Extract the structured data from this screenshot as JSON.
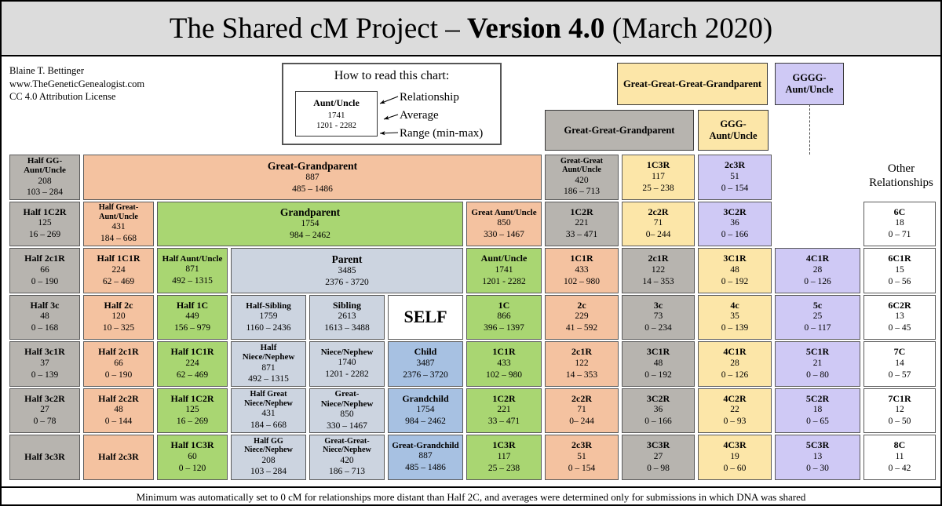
{
  "header": {
    "title_plain_1": "The Shared cM Project – ",
    "title_bold": "Version 4.0",
    "title_plain_2": " (March 2020)",
    "title_full": "The Shared cM Project – Version 4.0 (March 2020)"
  },
  "credits": {
    "line1": "Blaine T. Bettinger",
    "line2": "www.TheGeneticGenealogist.com",
    "line3": "CC 4.0 Attribution License"
  },
  "legend": {
    "title": "How to read this chart:",
    "sample_relationship": "Aunt/Uncle",
    "sample_average": "1741",
    "sample_range": "1201 - 2282",
    "label_relationship": "Relationship",
    "label_average": "Average",
    "label_range": "Range (min-max)"
  },
  "other_relationships_header": "Other\nRelationships",
  "other_relationships_header_line1": "Other",
  "other_relationships_header_line2": "Relationships",
  "footnote": "Minimum was automatically set to 0 cM for relationships more distant than Half 2C, and averages were determined only for submissions in which DNA was shared",
  "colors": {
    "banner": "#dcdcdc",
    "gray": "#b7b4af",
    "salmon": "#f4c2a0",
    "green": "#a9d672",
    "light_blue_gray": "#ccd4e0",
    "blue": "#a7c1e2",
    "yellow": "#fce6a8",
    "purple": "#cfc9f5",
    "white": "#ffffff",
    "border": "#5a5a5a"
  },
  "ancestor_boxes": [
    {
      "label": "Great-Great-Great-Grandparent",
      "color": "yellow"
    },
    {
      "label": "GGGG-Aunt/Uncle",
      "color": "purple"
    },
    {
      "label": "Great-Great-Grandparent",
      "color": "gray"
    },
    {
      "label": "GGG-Aunt/Uncle",
      "color": "yellow"
    }
  ],
  "chart_data": {
    "type": "table",
    "title": "The Shared cM Project – Version 4.0 (March 2020)",
    "units": "centimorgans (cM)",
    "rows": [
      [
        {
          "rel": "Half GG-Aunt/Uncle",
          "avg": "208",
          "rng": "103 – 284",
          "color": "gray"
        },
        {
          "rel": "Great-Grandparent",
          "avg": "887",
          "rng": "485 – 1486",
          "color": "salmon"
        },
        {
          "rel": "Great-Great Aunt/Uncle",
          "avg": "420",
          "rng": "186 – 713",
          "color": "gray"
        },
        {
          "rel": "1C3R",
          "avg": "117",
          "rng": "25 – 238",
          "color": "yellow"
        },
        {
          "rel": "2c3R",
          "avg": "51",
          "rng": "0 – 154",
          "color": "purple"
        }
      ],
      [
        {
          "rel": "Half 1C2R",
          "avg": "125",
          "rng": "16 – 269",
          "color": "gray"
        },
        {
          "rel": "Half Great-Aunt/Uncle",
          "avg": "431",
          "rng": "184 – 668",
          "color": "salmon"
        },
        {
          "rel": "Grandparent",
          "avg": "1754",
          "rng": "984 – 2462",
          "color": "green"
        },
        {
          "rel": "Great Aunt/Uncle",
          "avg": "850",
          "rng": "330 – 1467",
          "color": "salmon"
        },
        {
          "rel": "1C2R",
          "avg": "221",
          "rng": "33 – 471",
          "color": "gray"
        },
        {
          "rel": "2c2R",
          "avg": "71",
          "rng": "0– 244",
          "color": "yellow"
        },
        {
          "rel": "3C2R",
          "avg": "36",
          "rng": "0 – 166",
          "color": "purple"
        },
        {
          "rel": "6C",
          "avg": "18",
          "rng": "0 – 71",
          "color": "white"
        }
      ],
      [
        {
          "rel": "Half 2c1R",
          "avg": "66",
          "rng": "0 – 190",
          "color": "gray"
        },
        {
          "rel": "Half 1C1R",
          "avg": "224",
          "rng": "62 – 469",
          "color": "salmon"
        },
        {
          "rel": "Half Aunt/Uncle",
          "avg": "871",
          "rng": "492 – 1315",
          "color": "green"
        },
        {
          "rel": "Parent",
          "avg": "3485",
          "rng": "2376 - 3720",
          "color": "lblue"
        },
        {
          "rel": "Aunt/Uncle",
          "avg": "1741",
          "rng": "1201 - 2282",
          "color": "green"
        },
        {
          "rel": "1C1R",
          "avg": "433",
          "rng": "102 – 980",
          "color": "salmon"
        },
        {
          "rel": "2c1R",
          "avg": "122",
          "rng": "14 – 353",
          "color": "gray"
        },
        {
          "rel": "3C1R",
          "avg": "48",
          "rng": "0 – 192",
          "color": "yellow"
        },
        {
          "rel": "4C1R",
          "avg": "28",
          "rng": "0 – 126",
          "color": "purple"
        },
        {
          "rel": "6C1R",
          "avg": "15",
          "rng": "0 – 56",
          "color": "white"
        }
      ],
      [
        {
          "rel": "Half 3c",
          "avg": "48",
          "rng": "0 – 168",
          "color": "gray"
        },
        {
          "rel": "Half 2c",
          "avg": "120",
          "rng": "10 – 325",
          "color": "salmon"
        },
        {
          "rel": "Half 1C",
          "avg": "449",
          "rng": "156 – 979",
          "color": "green"
        },
        {
          "rel": "Half-Sibling",
          "avg": "1759",
          "rng": "1160 – 2436",
          "color": "lblue"
        },
        {
          "rel": "Sibling",
          "avg": "2613",
          "rng": "1613 – 3488",
          "color": "lblue"
        },
        {
          "rel": "SELF",
          "avg": "",
          "rng": "",
          "color": "white"
        },
        {
          "rel": "1C",
          "avg": "866",
          "rng": "396 – 1397",
          "color": "green"
        },
        {
          "rel": "2c",
          "avg": "229",
          "rng": "41 – 592",
          "color": "salmon"
        },
        {
          "rel": "3c",
          "avg": "73",
          "rng": "0 – 234",
          "color": "gray"
        },
        {
          "rel": "4c",
          "avg": "35",
          "rng": "0 – 139",
          "color": "yellow"
        },
        {
          "rel": "5c",
          "avg": "25",
          "rng": "0 – 117",
          "color": "purple"
        },
        {
          "rel": "6C2R",
          "avg": "13",
          "rng": "0 – 45",
          "color": "white"
        }
      ],
      [
        {
          "rel": "Half 3c1R",
          "avg": "37",
          "rng": "0 – 139",
          "color": "gray"
        },
        {
          "rel": "Half 2c1R",
          "avg": "66",
          "rng": "0 – 190",
          "color": "salmon"
        },
        {
          "rel": "Half 1C1R",
          "avg": "224",
          "rng": "62 – 469",
          "color": "green"
        },
        {
          "rel": "Half Niece/Nephew",
          "avg": "871",
          "rng": "492 – 1315",
          "color": "lblue"
        },
        {
          "rel": "Niece/Nephew",
          "avg": "1740",
          "rng": "1201 - 2282",
          "color": "lblue"
        },
        {
          "rel": "Child",
          "avg": "3487",
          "rng": "2376 – 3720",
          "color": "blue"
        },
        {
          "rel": "1C1R",
          "avg": "433",
          "rng": "102 – 980",
          "color": "green"
        },
        {
          "rel": "2c1R",
          "avg": "122",
          "rng": "14 – 353",
          "color": "salmon"
        },
        {
          "rel": "3C1R",
          "avg": "48",
          "rng": "0 – 192",
          "color": "gray"
        },
        {
          "rel": "4C1R",
          "avg": "28",
          "rng": "0 – 126",
          "color": "yellow"
        },
        {
          "rel": "5C1R",
          "avg": "21",
          "rng": "0 – 80",
          "color": "purple"
        },
        {
          "rel": "7C",
          "avg": "14",
          "rng": "0 – 57",
          "color": "white"
        }
      ],
      [
        {
          "rel": "Half 3c2R",
          "avg": "27",
          "rng": "0 – 78",
          "color": "gray"
        },
        {
          "rel": "Half 2c2R",
          "avg": "48",
          "rng": "0 – 144",
          "color": "salmon"
        },
        {
          "rel": "Half 1C2R",
          "avg": "125",
          "rng": "16 – 269",
          "color": "green"
        },
        {
          "rel": "Half Great Niece/Nephew",
          "avg": "431",
          "rng": "184 – 668",
          "color": "lblue"
        },
        {
          "rel": "Great-Niece/Nephew",
          "avg": "850",
          "rng": "330 – 1467",
          "color": "lblue"
        },
        {
          "rel": "Grandchild",
          "avg": "1754",
          "rng": "984 – 2462",
          "color": "blue"
        },
        {
          "rel": "1C2R",
          "avg": "221",
          "rng": "33 – 471",
          "color": "green"
        },
        {
          "rel": "2c2R",
          "avg": "71",
          "rng": "0– 244",
          "color": "salmon"
        },
        {
          "rel": "3C2R",
          "avg": "36",
          "rng": "0 – 166",
          "color": "gray"
        },
        {
          "rel": "4C2R",
          "avg": "22",
          "rng": "0 – 93",
          "color": "yellow"
        },
        {
          "rel": "5C2R",
          "avg": "18",
          "rng": "0 – 65",
          "color": "purple"
        },
        {
          "rel": "7C1R",
          "avg": "12",
          "rng": "0 – 50",
          "color": "white"
        }
      ],
      [
        {
          "rel": "Half 3c3R",
          "avg": "",
          "rng": "",
          "color": "gray"
        },
        {
          "rel": "Half 2c3R",
          "avg": "",
          "rng": "",
          "color": "salmon"
        },
        {
          "rel": "Half 1C3R",
          "avg": "60",
          "rng": "0 – 120",
          "color": "green"
        },
        {
          "rel": "Half GG Niece/Nephew",
          "avg": "208",
          "rng": "103 – 284",
          "color": "lblue"
        },
        {
          "rel": "Great-Great-Niece/Nephew",
          "avg": "420",
          "rng": "186 – 713",
          "color": "lblue"
        },
        {
          "rel": "Great-Grandchild",
          "avg": "887",
          "rng": "485 – 1486",
          "color": "blue"
        },
        {
          "rel": "1C3R",
          "avg": "117",
          "rng": "25 – 238",
          "color": "green"
        },
        {
          "rel": "2c3R",
          "avg": "51",
          "rng": "0 – 154",
          "color": "salmon"
        },
        {
          "rel": "3C3R",
          "avg": "27",
          "rng": "0 – 98",
          "color": "gray"
        },
        {
          "rel": "4C3R",
          "avg": "19",
          "rng": "0 – 60",
          "color": "yellow"
        },
        {
          "rel": "5C3R",
          "avg": "13",
          "rng": "0 – 30",
          "color": "purple"
        },
        {
          "rel": "8C",
          "avg": "11",
          "rng": "0 – 42",
          "color": "white"
        }
      ]
    ]
  }
}
